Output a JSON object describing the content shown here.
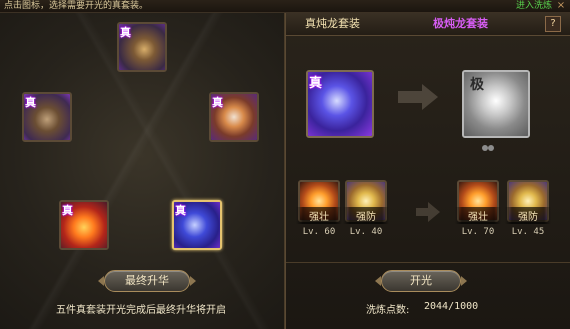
{
  "topbar": {
    "hint": "点击图标，选择需要开光的真套装。",
    "link": "进入洗炼",
    "close": "×"
  },
  "left_panel": {
    "slots": [
      {
        "name": "wolf-mount",
        "badge": "真"
      },
      {
        "name": "bear-mount",
        "badge": "真"
      },
      {
        "name": "tiger-mount",
        "badge": "真"
      },
      {
        "name": "phoenix-mount",
        "badge": "真"
      },
      {
        "name": "dragon-mount",
        "badge": "真"
      }
    ],
    "final_button": "最终升华",
    "footer_note": "五件真套装开光完成后最终升华将开启"
  },
  "right_panel": {
    "tab_current": "真炖龙套装",
    "tab_target": "极炖龙套装",
    "help": "?",
    "source_item": {
      "badge": "真"
    },
    "target_item": {
      "badge": "极"
    },
    "left_skills": [
      {
        "label": "强壮",
        "level": "Lv. 60"
      },
      {
        "label": "强防",
        "level": "Lv. 40"
      }
    ],
    "right_skills": [
      {
        "label": "强壮",
        "level": "Lv. 70"
      },
      {
        "label": "强防",
        "level": "Lv. 45"
      }
    ],
    "action_button": "开光",
    "points_label": "洗炼点数:",
    "points_value": "2044/1000"
  }
}
